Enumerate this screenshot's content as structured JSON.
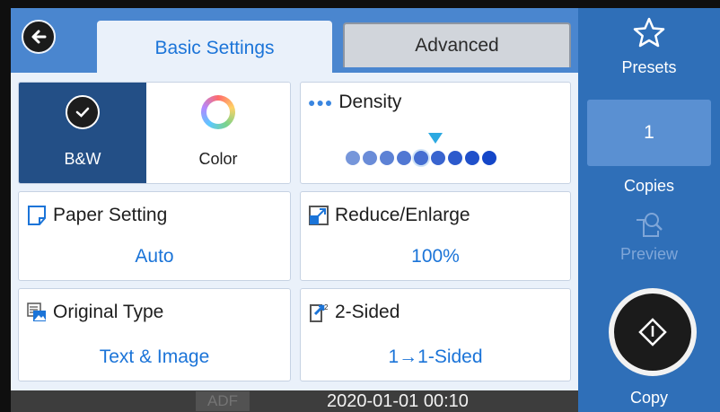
{
  "tabs": {
    "basic": "Basic Settings",
    "advanced": "Advanced"
  },
  "color_mode": {
    "bw_label": "B&W",
    "color_label": "Color",
    "selected": "B&W"
  },
  "density": {
    "label": "Density",
    "level": 5,
    "levels": 9
  },
  "paper": {
    "label": "Paper Setting",
    "value": "Auto"
  },
  "reduce": {
    "label": "Reduce/Enlarge",
    "value": "100%"
  },
  "original": {
    "label": "Original Type",
    "value": "Text & Image"
  },
  "sided": {
    "label": "2-Sided",
    "value": "1→1-Sided"
  },
  "status": {
    "adf": "ADF",
    "datetime": "2020-01-01 00:10"
  },
  "sidebar": {
    "presets": "Presets",
    "copies_value": "1",
    "copies_label": "Copies",
    "preview": "Preview",
    "copy": "Copy"
  },
  "colors": {
    "accent": "#1b74d8",
    "sidebar": "#2f6fb8",
    "panel": "#eaf1fa",
    "bw_selected": "#234f86"
  }
}
